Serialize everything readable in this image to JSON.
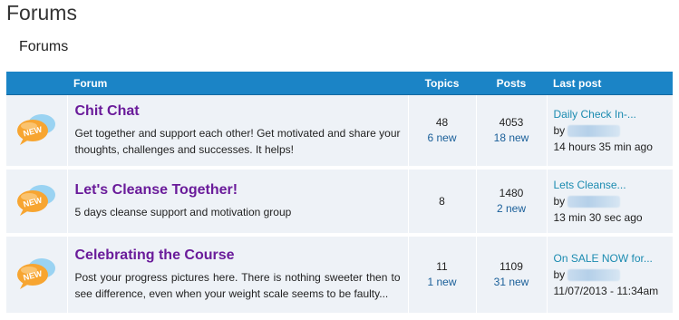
{
  "page": {
    "title": "Forums",
    "section_title": "Forums"
  },
  "table": {
    "headers": {
      "forum": "Forum",
      "topics": "Topics",
      "posts": "Posts",
      "last_post": "Last post"
    },
    "rows": [
      {
        "icon": "new-topic-bubble-icon",
        "badge": "NEW",
        "name": "Chit Chat",
        "description": "Get together and support each other! Get motivated and share your thoughts, challenges and successes.  It helps!",
        "topics": "48",
        "topics_new": "6 new",
        "posts": "4053",
        "posts_new": "18 new",
        "last_post_title": "Daily Check In-...",
        "last_post_by": "by",
        "last_post_time": "14 hours 35 min ago"
      },
      {
        "icon": "new-topic-bubble-icon",
        "badge": "NEW",
        "name": "Let's Cleanse Together!",
        "description": "5 days cleanse support and motivation group",
        "topics": "8",
        "topics_new": "",
        "posts": "1480",
        "posts_new": "2 new",
        "last_post_title": "Lets Cleanse...",
        "last_post_by": "by",
        "last_post_time": "13 min 30 sec ago"
      },
      {
        "icon": "new-topic-bubble-icon",
        "badge": "NEW",
        "name": "Celebrating the Course",
        "description": "Post your progress pictures here. There is nothing sweeter then to see difference, even when your weight scale seems to be faulty...",
        "topics": "11",
        "topics_new": "1 new",
        "posts": "1109",
        "posts_new": "31 new",
        "last_post_title": "On SALE NOW for...",
        "last_post_by": "by",
        "last_post_time": "11/07/2013 - 11:34am"
      }
    ]
  },
  "colors": {
    "header_bg": "#1b84c6",
    "forum_name": "#6a1b9a",
    "link": "#1b8bb0",
    "row_bg": "#eef2f7"
  }
}
